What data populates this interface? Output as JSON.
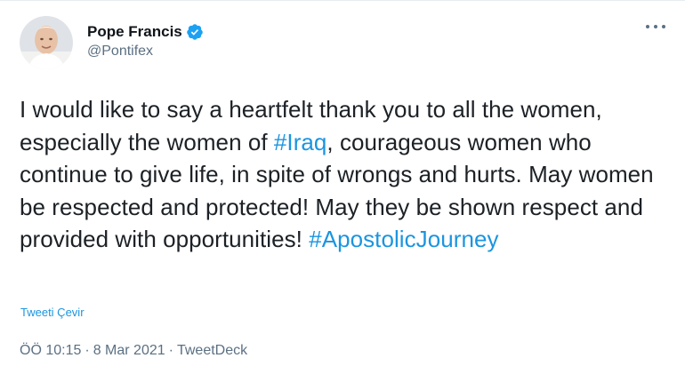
{
  "author": {
    "display_name": "Pope Francis",
    "handle": "@Pontifex",
    "verified": true,
    "avatar_icon": "person-portrait-avatar",
    "verified_icon": "verified-badge-icon",
    "verified_color": "#1da1f2"
  },
  "tweet": {
    "text_segments": [
      {
        "type": "text",
        "value": "I would like to say a heartfelt thank you to all the women, especially the women of "
      },
      {
        "type": "hashtag",
        "value": "#Iraq"
      },
      {
        "type": "text",
        "value": ", courageous women who continue to give life, in spite of wrongs and hurts. May women be respected and protected! May they be shown respect and provided with opportunities! "
      },
      {
        "type": "hashtag",
        "value": "#ApostolicJourney"
      }
    ],
    "translate_label": "Tweeti Çevir",
    "time": "ÖÖ 10:15",
    "separator": "·",
    "date": "8 Mar 2021",
    "source": "TweetDeck"
  },
  "colors": {
    "link": "#1b95e0",
    "secondary_text": "#5b7083"
  },
  "menu": {
    "more_icon": "more-horizontal-icon"
  }
}
